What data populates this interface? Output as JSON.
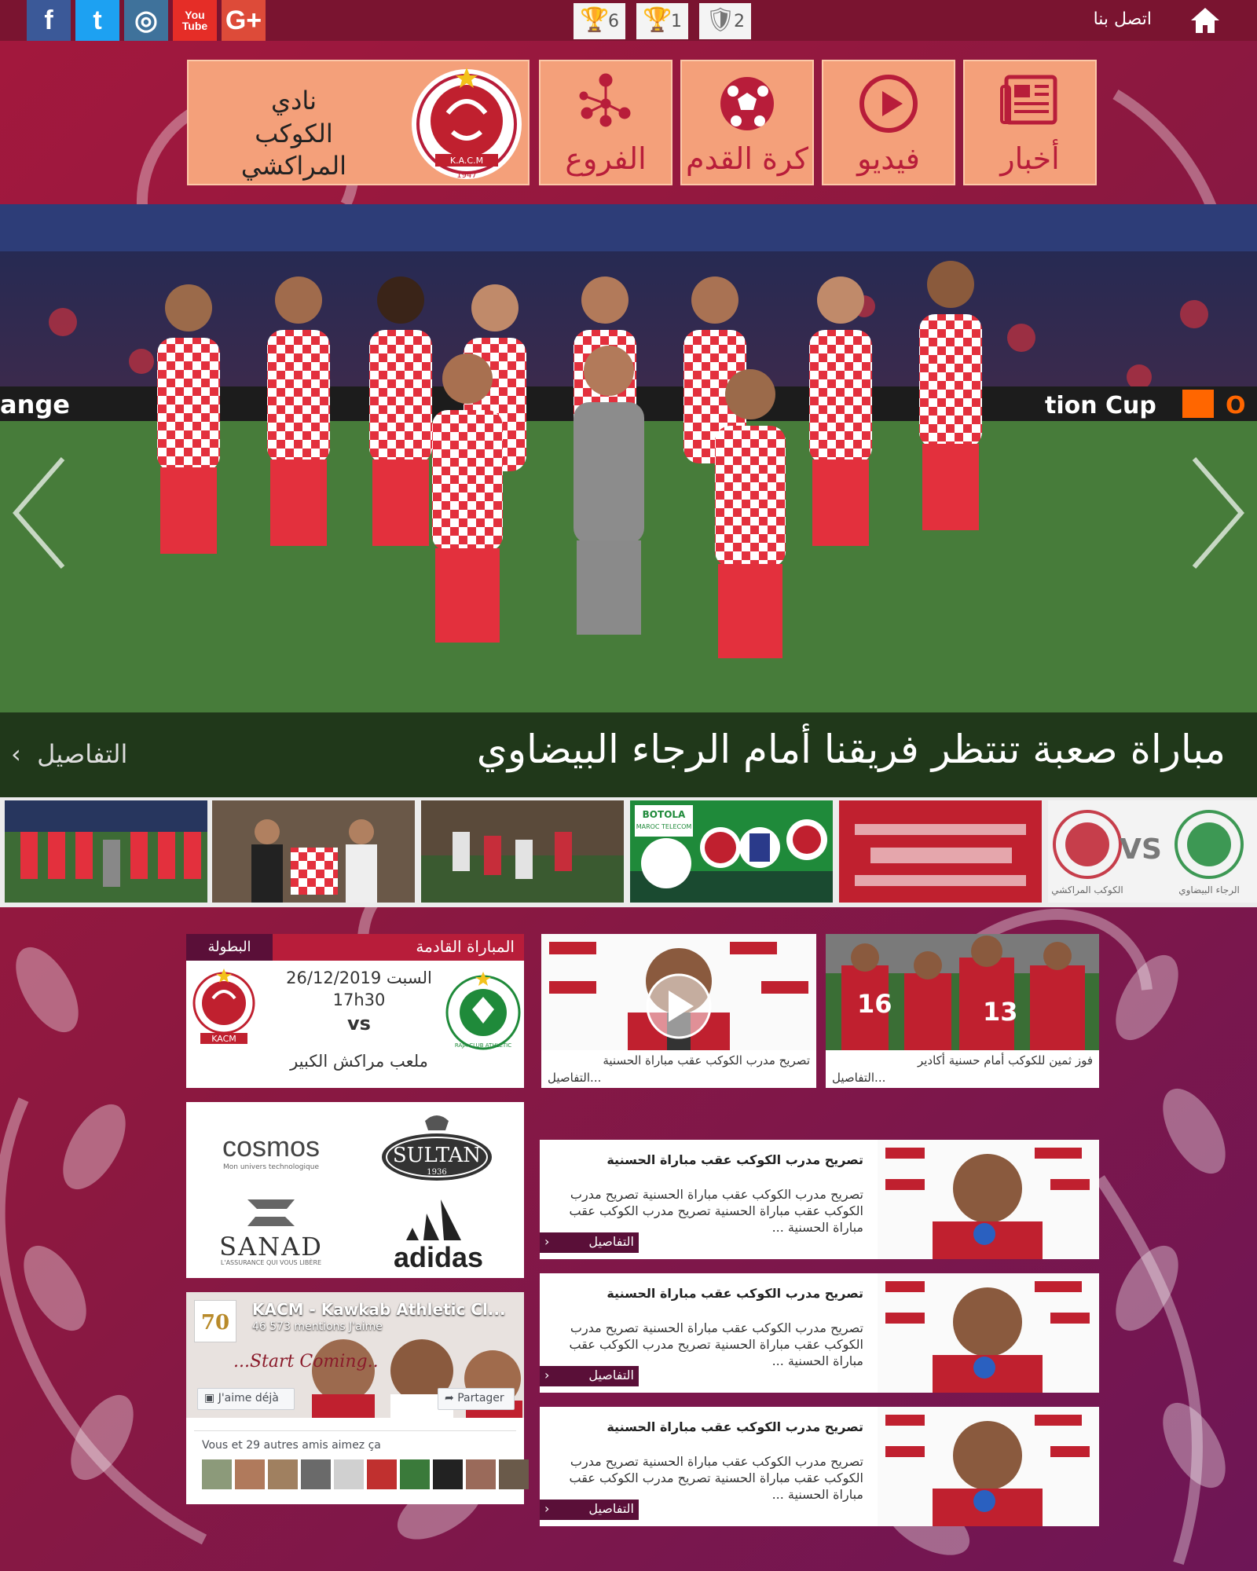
{
  "topbar": {
    "social": [
      {
        "name": "facebook",
        "glyph": "f",
        "color": "#3b5998"
      },
      {
        "name": "twitter",
        "glyph": "t",
        "color": "#1da1f2"
      },
      {
        "name": "instagram",
        "glyph": "◎",
        "color": "#3f729b"
      },
      {
        "name": "youtube",
        "glyph": "You Tube",
        "color": "#e52d27"
      },
      {
        "name": "google-plus",
        "glyph": "G+",
        "color": "#dd4b39"
      }
    ],
    "trophies": [
      "6",
      "1",
      "2"
    ],
    "contact_label": "اتصل بنا"
  },
  "header": {
    "club_name_line1": "نادي",
    "club_name_line2": "الكوكب المراكشي",
    "logo_letters": "K.A.C.M",
    "logo_year": "1947",
    "tiles": [
      {
        "label": "الفروع",
        "icon": "branches-icon"
      },
      {
        "label": "كرة القدم",
        "icon": "football-icon"
      },
      {
        "label": "فيديو",
        "icon": "play-icon"
      },
      {
        "label": "أخبار",
        "icon": "newspaper-icon"
      }
    ]
  },
  "slider": {
    "caption_title": "مباراة صعبة تنتظر فريقنا أمام الرجاء البيضاوي",
    "details_label": "التفاصيل",
    "ad_left": "ange",
    "ad_right": "tion Cup",
    "ad_right2": "O"
  },
  "thumbs": {
    "botola_line1": "BOTOLA",
    "botola_line2": "MAROC TELECOM",
    "vs_text": "VS",
    "team_left": "الكوكب المراكشي",
    "team_right": "الرجاء البيضاوي"
  },
  "next_match": {
    "header": "المباراة القادمة",
    "competition": "البطولة",
    "date": "السبت 26/12/2019",
    "time": "17h30",
    "vs": "vs",
    "stadium": "ملعب مراكش الكبير",
    "home_crest_text": "KACM",
    "away_crest_text": "RAJA CLUB ATHLETIC"
  },
  "sponsors": [
    "cosmos",
    "SULTAN",
    "SANAD",
    "adidas"
  ],
  "sponsor_sub": {
    "cosmos": "Mon univers technologique",
    "sultan": "1936",
    "sanad": "L'ASSURANCE QUI VOUS LIBÈRE"
  },
  "facebook": {
    "page_name": "KACM - Kawkab Athletic Cl...",
    "likes": "46 573 mentions J'aime",
    "banner_text": "...Start Coming..",
    "like_btn": "J'aime déjà",
    "share_btn": "Partager",
    "friends_text": "Vous et 29 autres amis aimez ça",
    "badge": "70"
  },
  "video_cards": [
    {
      "caption": "تصريح مدرب الكوكب عقب مباراة الحسنية",
      "more": "التفاصيل..."
    },
    {
      "caption": "فوز ثمين للكوكب أمام حسنية أكادير",
      "more": "التفاصيل..."
    }
  ],
  "news": [
    {
      "title": "تصريح مدرب الكوكب عقب مباراة الحسنية",
      "body": "تصريح مدرب الكوكب عقب مباراة الحسنية تصريح مدرب الكوكب عقب مباراة الحسنية تصريح مدرب الكوكب عقب مباراة الحسنية ...",
      "more": "التفاصيل"
    },
    {
      "title": "تصريح مدرب الكوكب عقب مباراة الحسنية",
      "body": "تصريح مدرب الكوكب عقب مباراة الحسنية تصريح مدرب الكوكب عقب مباراة الحسنية تصريح مدرب الكوكب عقب مباراة الحسنية ...",
      "more": "التفاصيل"
    },
    {
      "title": "تصريح مدرب الكوكب عقب مباراة الحسنية",
      "body": "تصريح مدرب الكوكب عقب مباراة الحسنية تصريح مدرب الكوكب عقب مباراة الحسنية تصريح مدرب الكوكب عقب مباراة الحسنية ...",
      "more": "التفاصيل"
    }
  ],
  "colors": {
    "brand_red": "#b81d3a",
    "tile": "#f4a07a",
    "dark_purple": "#5a0f38"
  }
}
